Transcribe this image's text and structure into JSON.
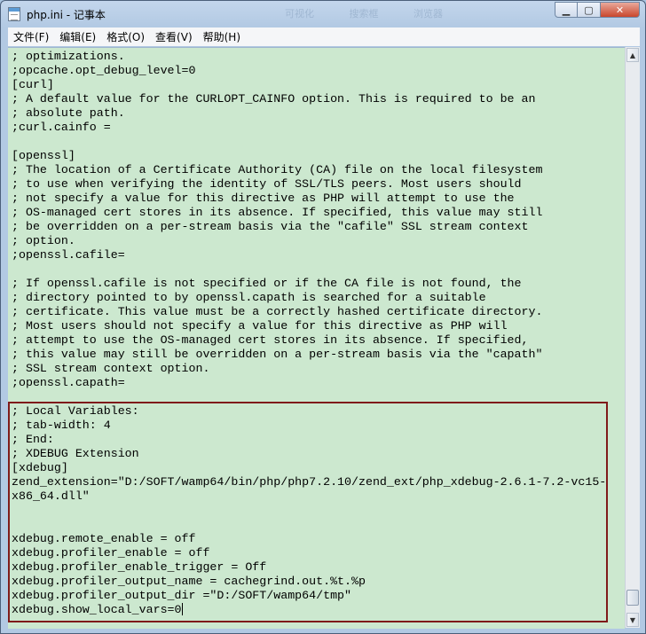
{
  "window": {
    "title": "php.ini - 记事本",
    "background_tabs": [
      "可视化",
      "搜索框",
      "浏览器"
    ],
    "controls": {
      "minimize": "▁",
      "maximize": "▢",
      "close": "✕"
    }
  },
  "menu": {
    "items": [
      "文件(F)",
      "编辑(E)",
      "格式(O)",
      "查看(V)",
      "帮助(H)"
    ]
  },
  "editor": {
    "lines": [
      "; optimizations.",
      ";opcache.opt_debug_level=0",
      "[curl]",
      "; A default value for the CURLOPT_CAINFO option. This is required to be an",
      "; absolute path.",
      ";curl.cainfo =",
      "",
      "[openssl]",
      "; The location of a Certificate Authority (CA) file on the local filesystem",
      "; to use when verifying the identity of SSL/TLS peers. Most users should",
      "; not specify a value for this directive as PHP will attempt to use the",
      "; OS-managed cert stores in its absence. If specified, this value may still",
      "; be overridden on a per-stream basis via the \"cafile\" SSL stream context",
      "; option.",
      ";openssl.cafile=",
      "",
      "; If openssl.cafile is not specified or if the CA file is not found, the",
      "; directory pointed to by openssl.capath is searched for a suitable",
      "; certificate. This value must be a correctly hashed certificate directory.",
      "; Most users should not specify a value for this directive as PHP will",
      "; attempt to use the OS-managed cert stores in its absence. If specified,",
      "; this value may still be overridden on a per-stream basis via the \"capath\"",
      "; SSL stream context option.",
      ";openssl.capath=",
      "",
      "; Local Variables:",
      "; tab-width: 4",
      "; End:",
      "; XDEBUG Extension",
      "[xdebug]",
      "zend_extension=\"D:/SOFT/wamp64/bin/php/php7.2.10/zend_ext/php_xdebug-2.6.1-7.2-vc15-",
      "x86_64.dll\"",
      "",
      "",
      "xdebug.remote_enable = off",
      "xdebug.profiler_enable = off",
      "xdebug.profiler_enable_trigger = Off",
      "xdebug.profiler_output_name = cachegrind.out.%t.%p",
      "xdebug.profiler_output_dir =\"D:/SOFT/wamp64/tmp\"",
      "xdebug.show_local_vars=0"
    ]
  },
  "colors": {
    "editor_background": "#cce8cf",
    "highlight_border": "#7f1a1a"
  }
}
